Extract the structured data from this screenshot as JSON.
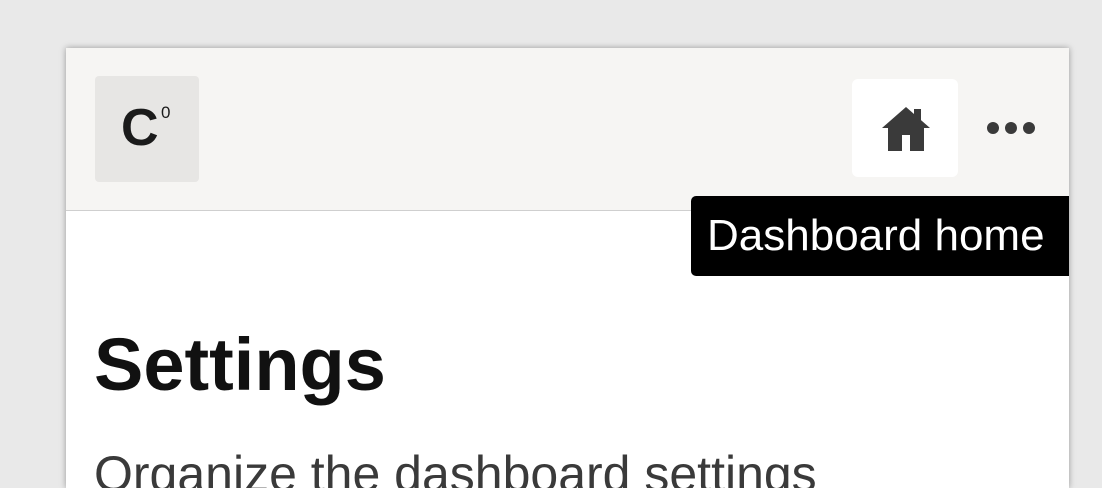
{
  "header": {
    "logo": {
      "letter": "C",
      "superscript": "0"
    },
    "home_button": {
      "icon": "home-icon",
      "tooltip": "Dashboard home"
    },
    "more_button": {
      "icon": "more-horizontal-icon"
    }
  },
  "main": {
    "title": "Settings",
    "description": "Organize the dashboard settings"
  },
  "colors": {
    "background": "#e9e9e9",
    "topbar": "#f6f5f3",
    "tooltip_bg": "#000000",
    "tooltip_text": "#ffffff",
    "title_text": "#111111"
  }
}
